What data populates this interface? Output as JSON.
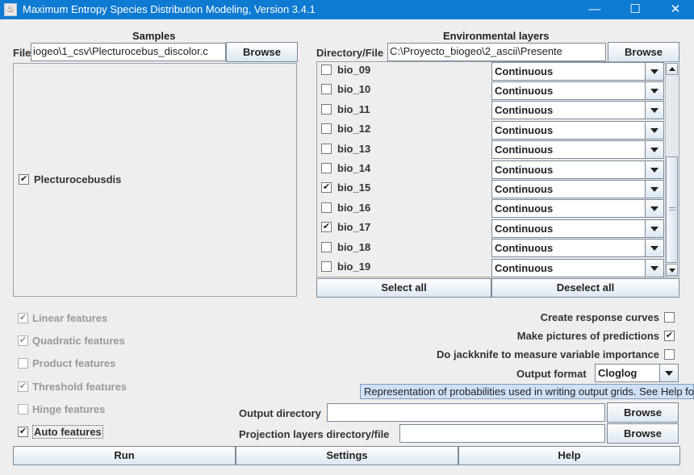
{
  "window": {
    "title": "Maximum Entropy Species Distribution Modeling, Version 3.4.1",
    "minimize": "—",
    "maximize": "☐",
    "close": "✕"
  },
  "samples": {
    "heading": "Samples",
    "file_label": "File",
    "file_value": "iogeo\\1_csv\\Plecturocebus_discolor.c",
    "browse": "Browse",
    "species": [
      {
        "name": "Plecturocebusdis",
        "checked": true
      }
    ]
  },
  "env": {
    "heading": "Environmental layers",
    "dir_label": "Directory/File",
    "dir_value": "C:\\Proyecto_biogeo\\2_ascii\\Presente",
    "browse": "Browse",
    "layers": [
      {
        "name": "bio_09",
        "checked": false,
        "type": "Continuous"
      },
      {
        "name": "bio_10",
        "checked": false,
        "type": "Continuous"
      },
      {
        "name": "bio_11",
        "checked": false,
        "type": "Continuous"
      },
      {
        "name": "bio_12",
        "checked": false,
        "type": "Continuous"
      },
      {
        "name": "bio_13",
        "checked": false,
        "type": "Continuous"
      },
      {
        "name": "bio_14",
        "checked": false,
        "type": "Continuous"
      },
      {
        "name": "bio_15",
        "checked": true,
        "type": "Continuous"
      },
      {
        "name": "bio_16",
        "checked": false,
        "type": "Continuous"
      },
      {
        "name": "bio_17",
        "checked": true,
        "type": "Continuous"
      },
      {
        "name": "bio_18",
        "checked": false,
        "type": "Continuous"
      },
      {
        "name": "bio_19",
        "checked": false,
        "type": "Continuous"
      }
    ],
    "select_all": "Select all",
    "deselect_all": "Deselect all"
  },
  "features": [
    {
      "label": "Linear features",
      "checked": true,
      "enabled": false
    },
    {
      "label": "Quadratic features",
      "checked": true,
      "enabled": false
    },
    {
      "label": "Product features",
      "checked": false,
      "enabled": false
    },
    {
      "label": "Threshold features",
      "checked": true,
      "enabled": false
    },
    {
      "label": "Hinge features",
      "checked": false,
      "enabled": false
    },
    {
      "label": "Auto features",
      "checked": true,
      "enabled": true
    }
  ],
  "options": {
    "response_curves": {
      "label": "Create response curves",
      "checked": false
    },
    "pictures": {
      "label": "Make pictures of predictions",
      "checked": true
    },
    "jackknife": {
      "label": "Do jackknife to measure variable importance",
      "checked": false
    },
    "output_format_label": "Output format",
    "output_format_value": "Cloglog",
    "tooltip": "Representation of probabilities used in writing output grids.  See Help for details."
  },
  "output": {
    "dir_label": "Output directory",
    "dir_value": "",
    "browse": "Browse",
    "proj_label": "Projection layers directory/file",
    "proj_value": "",
    "proj_browse": "Browse"
  },
  "bottom": {
    "run": "Run",
    "settings": "Settings",
    "help": "Help"
  },
  "check_glyph": "✔"
}
